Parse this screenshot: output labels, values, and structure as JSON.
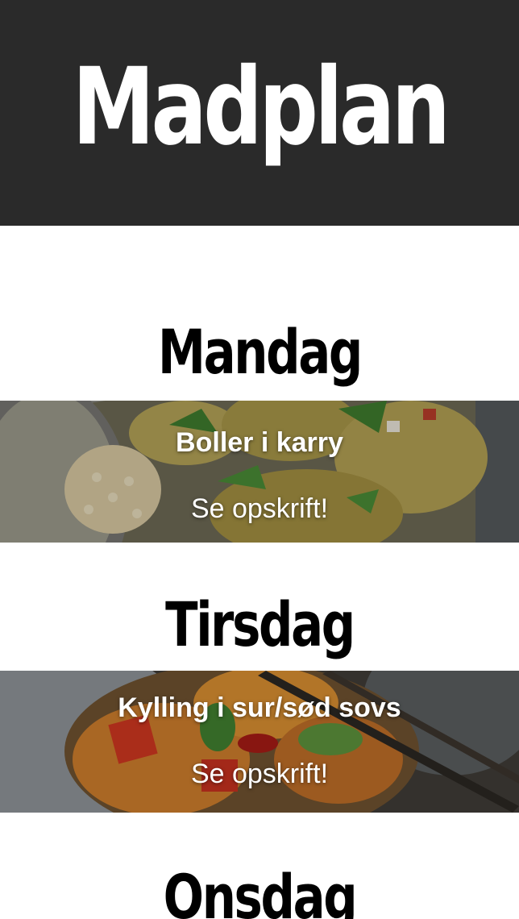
{
  "header": {
    "title": "Madplan",
    "background": "#2a2a2a"
  },
  "days": [
    {
      "day": "Mandag",
      "recipe": "Boller i karry",
      "link_label": "Se opskrift!",
      "photo": "meatballs-curry-bowl"
    },
    {
      "day": "Tirsdag",
      "recipe": "Kylling i sur/sød sovs",
      "link_label": "Se opskrift!",
      "photo": "sweet-sour-chicken-bowl"
    },
    {
      "day": "Onsdag"
    }
  ]
}
